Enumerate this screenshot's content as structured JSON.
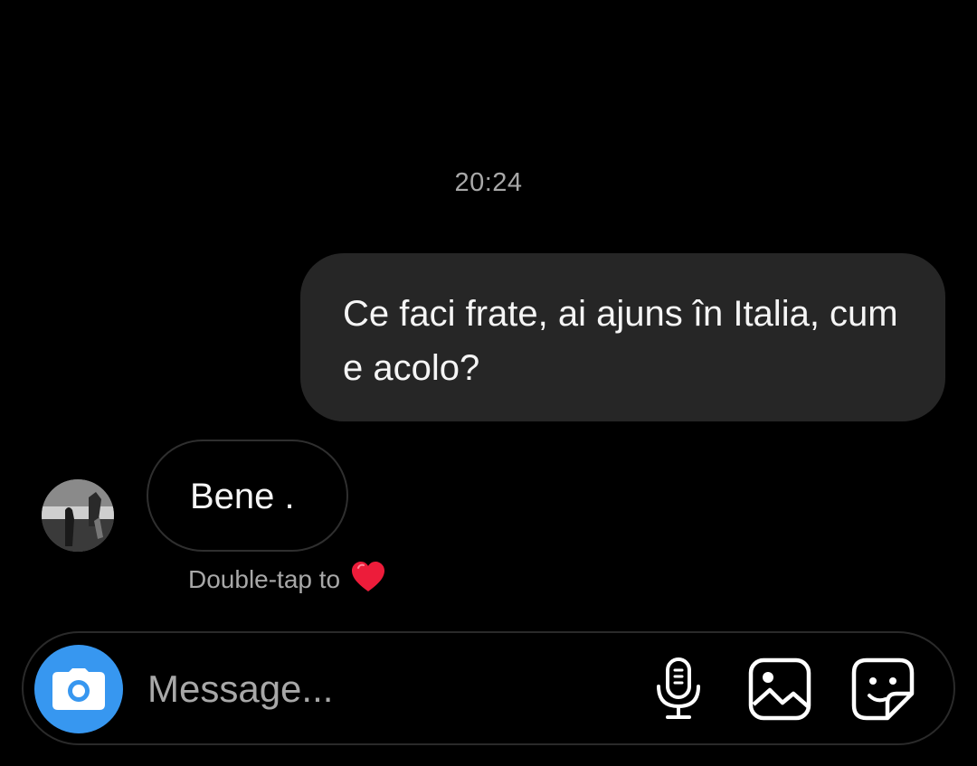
{
  "chat": {
    "timestamp": "20:24",
    "outgoing_message": "Ce faci frate, ai ajuns în Italia, cum e acolo?",
    "incoming_message": "Bene .",
    "reaction_hint": "Double-tap to",
    "reaction_emoji": "heart"
  },
  "composer": {
    "placeholder": "Message...",
    "icons": [
      "camera-icon",
      "microphone-icon",
      "gallery-icon",
      "sticker-icon"
    ]
  },
  "colors": {
    "background": "#000000",
    "outgoing_bubble": "#262626",
    "incoming_bubble_border": "#2f2f2f",
    "accent": "#3797f0",
    "secondary_text": "#a8a8a8",
    "heart": "#ed1c3a"
  }
}
